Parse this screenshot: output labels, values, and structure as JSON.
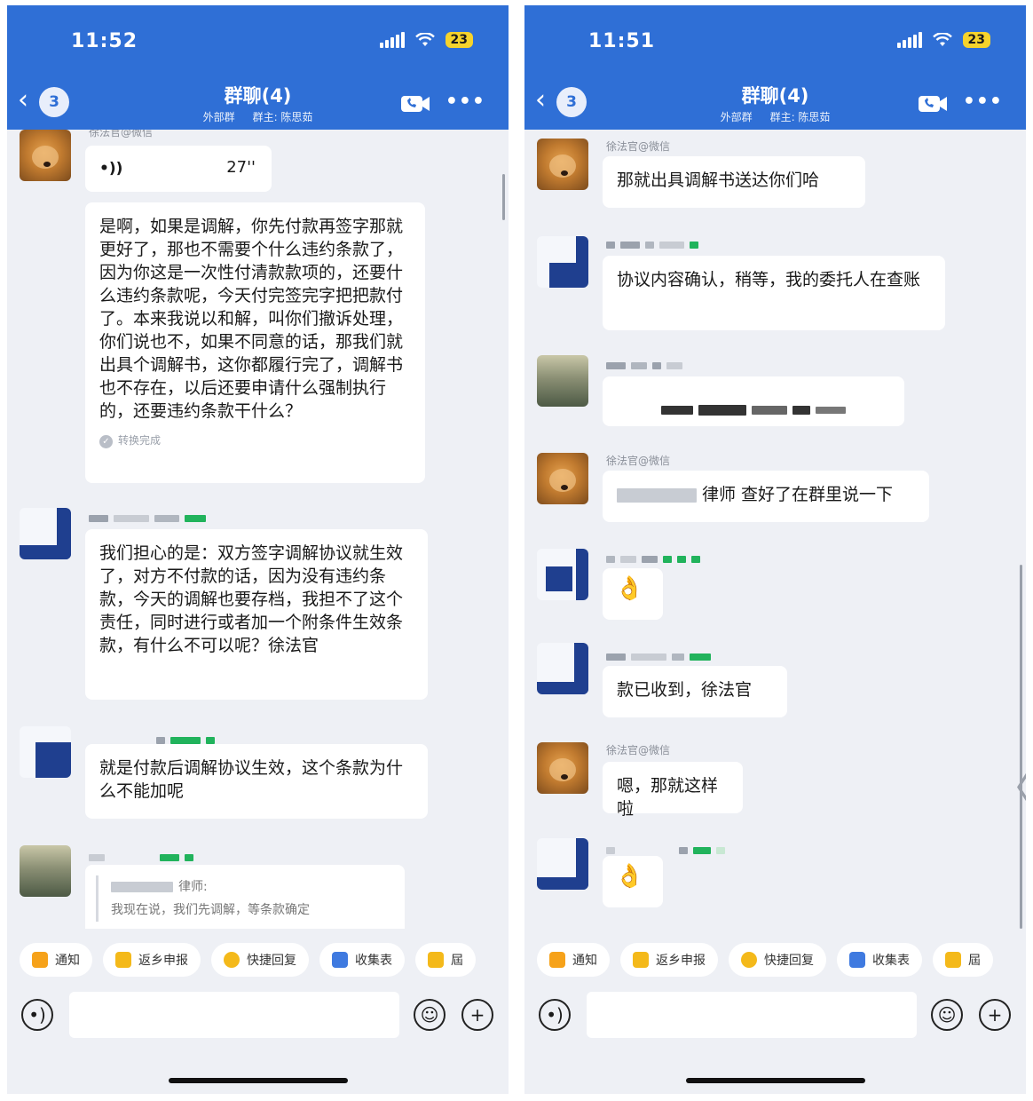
{
  "left": {
    "time": "11:52",
    "battery": "23",
    "badge": "3",
    "title": "群聊(4)",
    "subtitle_ext": "外部群",
    "subtitle_owner": "群主: 陈思茹",
    "top_name": "徐法官@微信",
    "voice_icon": "•))",
    "voice_duration": "27''",
    "transcript": "是啊，如果是调解，你先付款再签字那就更好了，那也不需要个什么违约条款了，因为你这是一次性付清款款项的，还要什么违约条款呢，今天付完签完字把把款付了。本来我说以和解，叫你们撤诉处理，你们说也不，如果不同意的话，那我们就出具个调解书，这你都履行完了，调解书也不存在，以后还要申请什么强制执行的，还要违约条款干什么？",
    "transcript_status": "转换完成",
    "msg2": "我们担心的是：双方签字调解协议就生效了，对方不付款的话，因为没有违约条款，今天的调解也要存档，我担不了这个责任，同时进行或者加一个附条件生效条款，有什么不可以呢？徐法官",
    "msg3": "就是付款后调解协议生效，这个条款为什么不能加呢",
    "quote_name": "律师:",
    "quote_text": "我现在说，我们先调解，等条款确定"
  },
  "right": {
    "time": "11:51",
    "battery": "23",
    "badge": "3",
    "title": "群聊(4)",
    "subtitle_ext": "外部群",
    "subtitle_owner": "群主: 陈思茹",
    "judge_name": "徐法官@微信",
    "msg1": "那就出具调解书送达你们哈",
    "msg2": "协议内容确认，稍等，我的委托人在查账",
    "msg4": "律师 查好了在群里说一下",
    "emoji_ok": "👌",
    "msg6": "款已收到，徐法官",
    "msg7": "嗯，那就这样啦",
    "side_arrow": "〈"
  },
  "toolbar": {
    "chip1": "通知",
    "chip2": "返乡申报",
    "chip3": "快捷回复",
    "chip4": "收集表",
    "chip5": "屆"
  },
  "colors": {
    "header": "#2f6fd6",
    "background": "#eef0f5",
    "bubble": "#ffffff",
    "wechat_green": "#21b35c",
    "battery": "#f6d32b"
  }
}
